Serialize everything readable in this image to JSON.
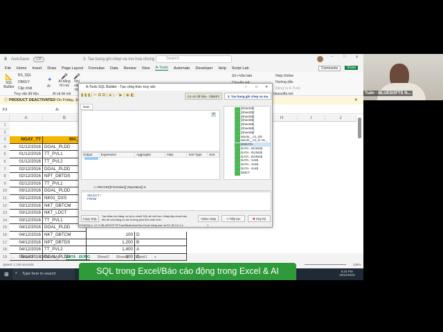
{
  "window": {
    "autosave": "AutoSave",
    "autosave_state": "Off",
    "doc_title": "3. Tao bang ghi chep va mo hoa chong bi...",
    "search_placeholder": "Search"
  },
  "menu": [
    "File",
    "Home",
    "Insert",
    "Draw",
    "Page Layout",
    "Formulas",
    "Data",
    "Review",
    "View",
    "A-Tools",
    "Automate",
    "Developer",
    "Help",
    "Script Lab"
  ],
  "menu_active": "A-Tools",
  "header_buttons": {
    "comments": "Comments",
    "share": "Share"
  },
  "ribbon": {
    "sql_builder": "SQL Builder",
    "bs_sql": "BS_SQL",
    "dbkey": "DBKEY",
    "cap_nhat": "Cập nhật",
    "group1": "Truy vấn dữ liệu",
    "ai": "AI",
    "ai_bang_loi_noi": "AI bằng lời nói",
    "noi_van_ban": "Nói văn bả",
    "group2": "AI và lời nói",
    "so_van_ban": "Số->Văn bản",
    "chuyen_ma": "Chuyển mã",
    "help_online": "Help Online",
    "huong_dan": "Hướng dẫn",
    "dang_ky": "Đăng ký A-Tools",
    "bluesofts": "bluesofts.net"
  },
  "notice": {
    "title": "PRODUCT DEACTIVATED",
    "text": "On Friday, January 2, 2"
  },
  "formula_bar": {
    "name_box": "F3",
    "fx": "fx"
  },
  "columns": [
    "A",
    "B",
    "H",
    "I",
    "J"
  ],
  "rows": [
    {
      "n": "1",
      "a": "",
      "b": ""
    },
    {
      "n": "2",
      "a": "",
      "b": ""
    },
    {
      "n": "3",
      "a": "NGAY_TT",
      "b": "MA_CV"
    },
    {
      "n": "4",
      "a": "01/12/2016",
      "b": "DOAL_PLDD"
    },
    {
      "n": "5",
      "a": "01/12/2016",
      "b": "TT_PVL1"
    },
    {
      "n": "6",
      "a": "01/12/2016",
      "b": "TT_PVL2"
    },
    {
      "n": "7",
      "a": "02/12/2016",
      "b": "DOAL_PLDD"
    },
    {
      "n": "8",
      "a": "02/12/2016",
      "b": "NPT_DBTDS"
    },
    {
      "n": "9",
      "a": "02/12/2016",
      "b": "TT_PVL1"
    },
    {
      "n": "10",
      "a": "03/12/2016",
      "b": "DOAL_PLDD"
    },
    {
      "n": "11",
      "a": "03/12/2016",
      "b": "NK01_DXS"
    },
    {
      "n": "12",
      "a": "03/12/2016",
      "b": "NKT_DBTCM"
    },
    {
      "n": "13",
      "a": "03/12/2016",
      "b": "NKT_LDCT"
    },
    {
      "n": "14",
      "a": "03/12/2016",
      "b": "TT_PVL1"
    },
    {
      "n": "15",
      "a": "04/12/2016",
      "b": "DOAL_PLDD"
    },
    {
      "n": "16",
      "a": "04/12/2016",
      "b": "NKT_DBTCM",
      "c": "100",
      "d": "D"
    },
    {
      "n": "17",
      "a": "04/12/2016",
      "b": "NPT_DBTDS",
      "c": "1,200",
      "d": "B"
    },
    {
      "n": "18",
      "a": "04/12/2016",
      "b": "TT_PVL2",
      "c": "1,400",
      "d": "A"
    },
    {
      "n": "19",
      "a": "05/12/2016",
      "b": "DOAL_PLDD",
      "c": "100",
      "d": "C"
    }
  ],
  "sheets": [
    "Sheet3",
    "DATA - SAI",
    "DATA - ĐÚNG",
    "Sheet2",
    "Sheet4",
    "Sheet1"
  ],
  "active_sheet": "DATA - ĐÚNG",
  "status": {
    "text": "Speed: 1.145 seconds",
    "zoom": "146%"
  },
  "dialog": {
    "title": "A-Tools SQL Builder - Tạo công thức truy vấn",
    "connection": "Cơ sở dữ liệu - DBKEY",
    "file_select": "3. Tao bang ghi chep va ma",
    "tab": "Nam",
    "grid_headers": [
      "Output",
      "Expression",
      "Aggregate",
      "Alias",
      "Sort Type",
      "Sort"
    ],
    "tree": [
      "[Sheet1$]",
      "[Sheet2$]",
      "[Sheet2$]",
      "[Sheet2$]",
      "[Sheet4$]",
      "[Sheet4$]",
      "[Sheet4$]",
      "atools__A1_D6",
      "atools__A1_D HL_",
      "BSDATA",
      "DATA - ĐÚNG$",
      "DATA - ĐÚNG$",
      "DATA - ĐÚNG$",
      "DATA - SAI$",
      "DATA - SAI$",
      "DATA - SAI$",
      "DMCT"
    ],
    "func": "RECNO([FirstValue][,StepValue])",
    "sql_line1": "SELECT *",
    "sql_line2": "FROM",
    "copy_sql": "Copy SQL",
    "hint": "Tạo Alias cho bảng, số ký tự chuỗi SQL sẽ nhỏ hơn. Nhấp đúp chuột vào tiêu đề của bảng có các trường phía trên màn hình.",
    "video_help": "Video Help",
    "tiep_tuc": "Tiếp tục",
    "huy_bo": "Hủy bỏ",
    "statusline": "LEN(SQL)= 12   C:\\BLUESOFTS\\Tuan\\Business\\Học Excel nâng cao và SC (R,C)=1,1",
    "status_num": "1"
  },
  "taskbar": {
    "search": "Type here to search",
    "time": "8:34 PM",
    "date": "19/12/2023"
  },
  "banner": "SQL trong Excel/Báo cáo động trong Excel & AI",
  "webcam": {
    "name": "Tuấn - BLUESOFTS N..."
  },
  "colors": {
    "excel_green": "#107c41",
    "header_orange": "#f5b400",
    "banner": "#2e9a3a"
  }
}
